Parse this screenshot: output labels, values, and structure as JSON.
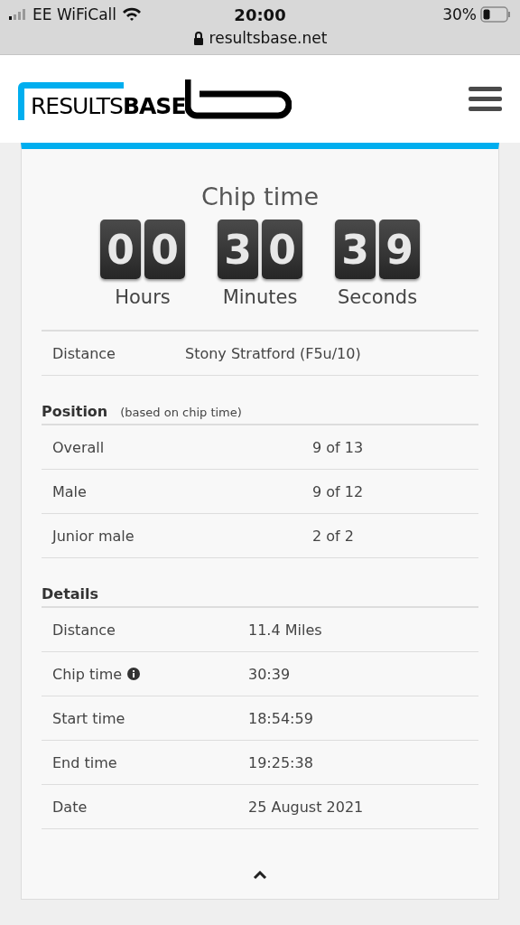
{
  "status_bar": {
    "carrier": "EE WiFiCall",
    "time": "20:00",
    "battery": "30%",
    "url": "resultsbase.net"
  },
  "logo": {
    "word_light": "RESULTS",
    "word_bold": "BASE"
  },
  "chip_time": {
    "title": "Chip time",
    "units": [
      {
        "digits": [
          "0",
          "0"
        ],
        "label": "Hours"
      },
      {
        "digits": [
          "3",
          "0"
        ],
        "label": "Minutes"
      },
      {
        "digits": [
          "3",
          "9"
        ],
        "label": "Seconds"
      }
    ]
  },
  "summary": [
    {
      "label": "Distance",
      "value": "Stony Stratford (F5u/10)"
    }
  ],
  "position": {
    "title": "Position",
    "note": "(based on chip time)",
    "rows": [
      {
        "label": "Overall",
        "value": "9 of 13"
      },
      {
        "label": "Male",
        "value": "9 of 12"
      },
      {
        "label": "Junior male",
        "value": "2 of 2"
      }
    ]
  },
  "details": {
    "title": "Details",
    "rows": [
      {
        "label": "Distance",
        "value": "11.4 Miles",
        "info": false
      },
      {
        "label": "Chip time",
        "value": "30:39",
        "info": true
      },
      {
        "label": "Start time",
        "value": "18:54:59",
        "info": false
      },
      {
        "label": "End time",
        "value": "19:25:38",
        "info": false
      },
      {
        "label": "Date",
        "value": "25 August 2021",
        "info": false
      }
    ]
  }
}
